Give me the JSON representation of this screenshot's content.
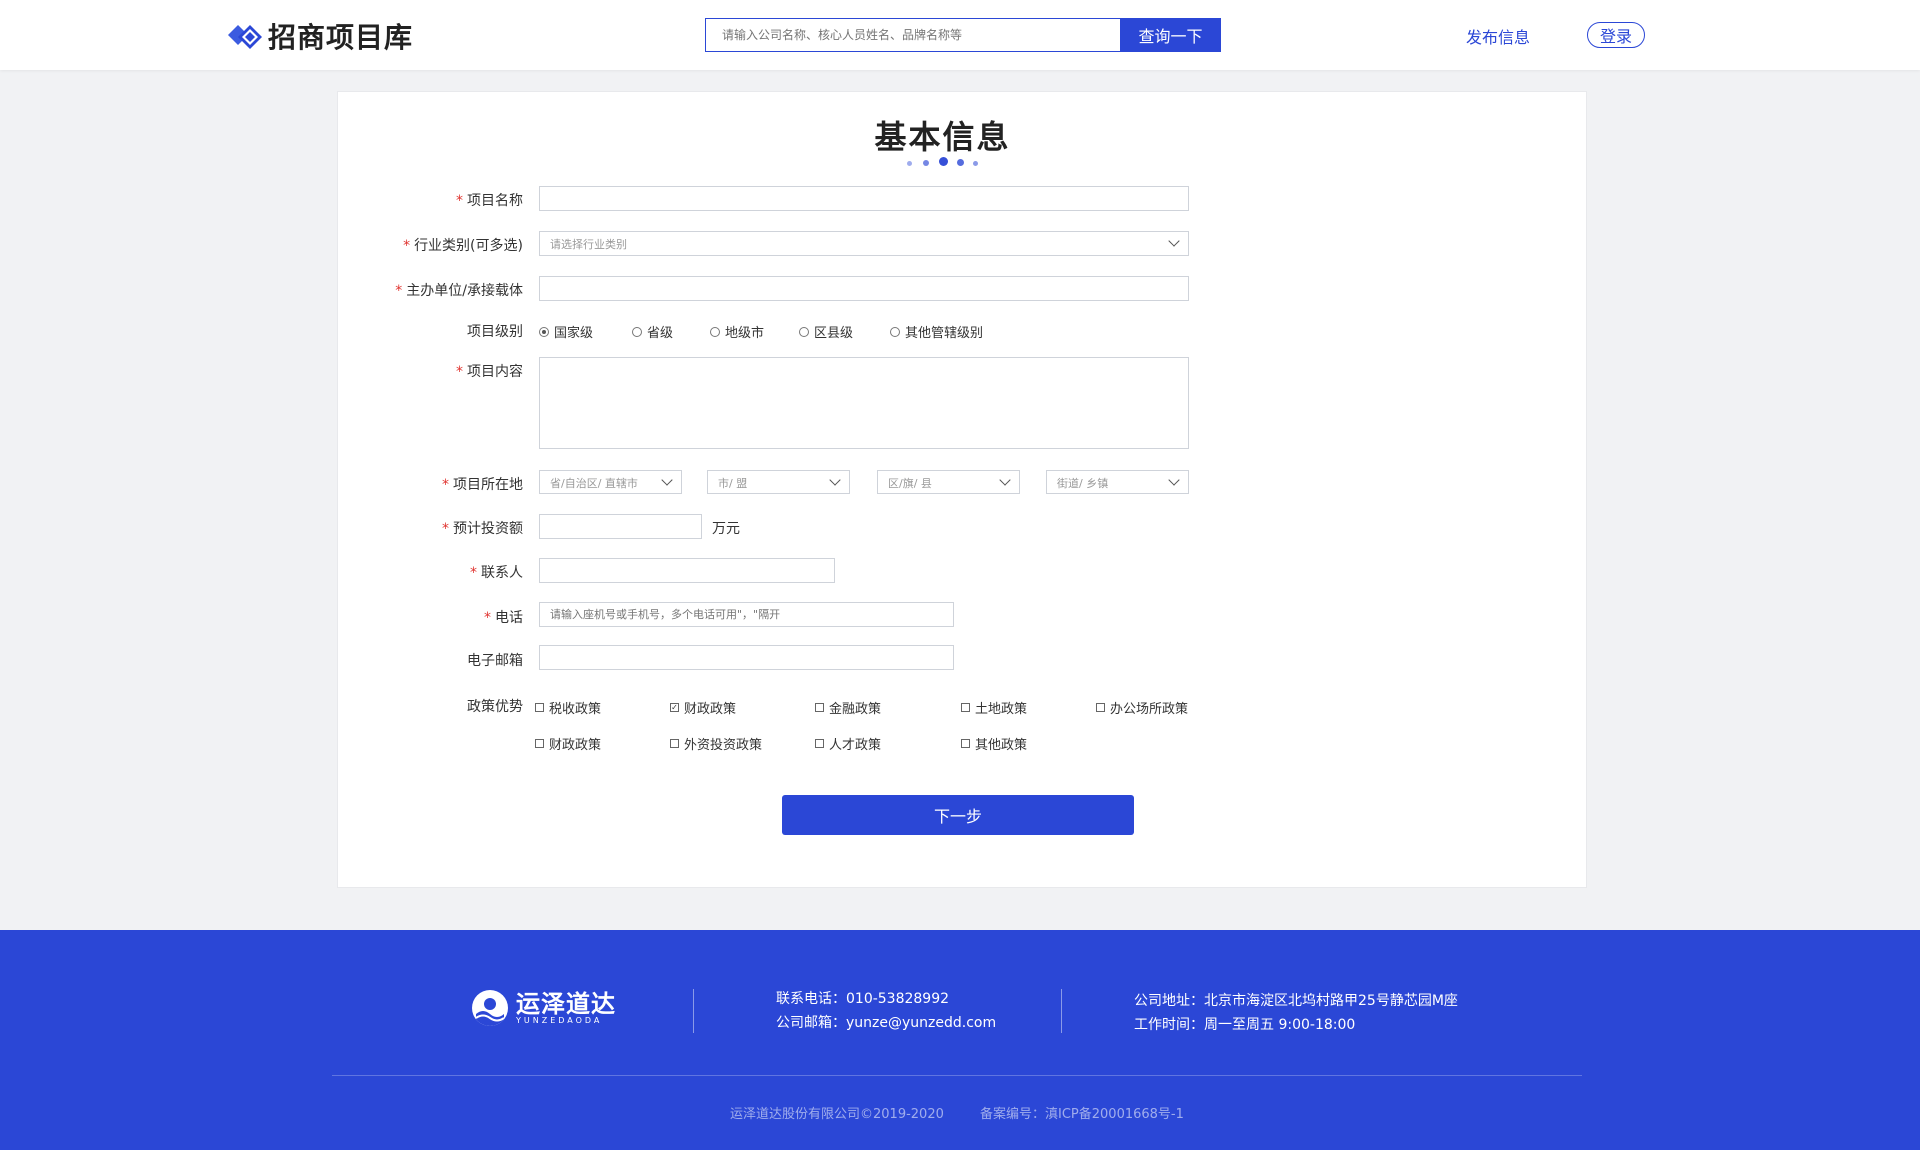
{
  "colors": {
    "accent": "#2b47d6",
    "required": "#e0332f"
  },
  "header": {
    "logo_text": "招商项目库",
    "search_placeholder": "请输入公司名称、核心人员姓名、品牌名称等",
    "search_button": "查询一下",
    "publish_link": "发布信息",
    "login_button": "登录"
  },
  "form": {
    "title": "基本信息",
    "project_name": {
      "label": "项目名称",
      "value": ""
    },
    "industry": {
      "label": "行业类别(可多选)",
      "placeholder": "请选择行业类别"
    },
    "host_unit": {
      "label": "主办单位/承接载体",
      "value": ""
    },
    "level": {
      "label": "项目级别",
      "options": [
        "国家级",
        "省级",
        "地级市",
        "区县级",
        "其他管辖级别"
      ],
      "selected": "国家级"
    },
    "content": {
      "label": "项目内容",
      "value": ""
    },
    "location": {
      "label": "项目所在地",
      "selects": [
        "省/自治区/ 直辖市",
        "市/ 盟",
        "区/旗/ 县",
        "街道/ 乡镇"
      ]
    },
    "investment": {
      "label": "预计投资额",
      "unit": "万元",
      "value": ""
    },
    "contact": {
      "label": "联系人",
      "value": ""
    },
    "phone": {
      "label": "电话",
      "placeholder": "请输入座机号或手机号，多个电话可用\"，\"隔开"
    },
    "email": {
      "label": "电子邮箱",
      "value": ""
    },
    "policy": {
      "label": "政策优势",
      "options": [
        {
          "label": "税收政策",
          "checked": false
        },
        {
          "label": "财政政策",
          "checked": true
        },
        {
          "label": "金融政策",
          "checked": false
        },
        {
          "label": "土地政策",
          "checked": false
        },
        {
          "label": "办公场所政策",
          "checked": false
        },
        {
          "label": "财政政策",
          "checked": false
        },
        {
          "label": "外资投资政策",
          "checked": false
        },
        {
          "label": "人才政策",
          "checked": false
        },
        {
          "label": "其他政策",
          "checked": false
        }
      ]
    },
    "next_button": "下一步"
  },
  "footer": {
    "logo_text": "运泽道达",
    "logo_sub": "YUNZEDAODA",
    "phone": "联系电话：010-53828992",
    "email": "公司邮箱：yunze@yunzedd.com",
    "address": "公司地址：北京市海淀区北坞村路甲25号静芯园M座",
    "hours": "工作时间：周一至周五  9:00-18:00",
    "copyright": "运泽道达股份有限公司©2019-2020",
    "icp": "备案编号：滇ICP备20001668号-1"
  }
}
